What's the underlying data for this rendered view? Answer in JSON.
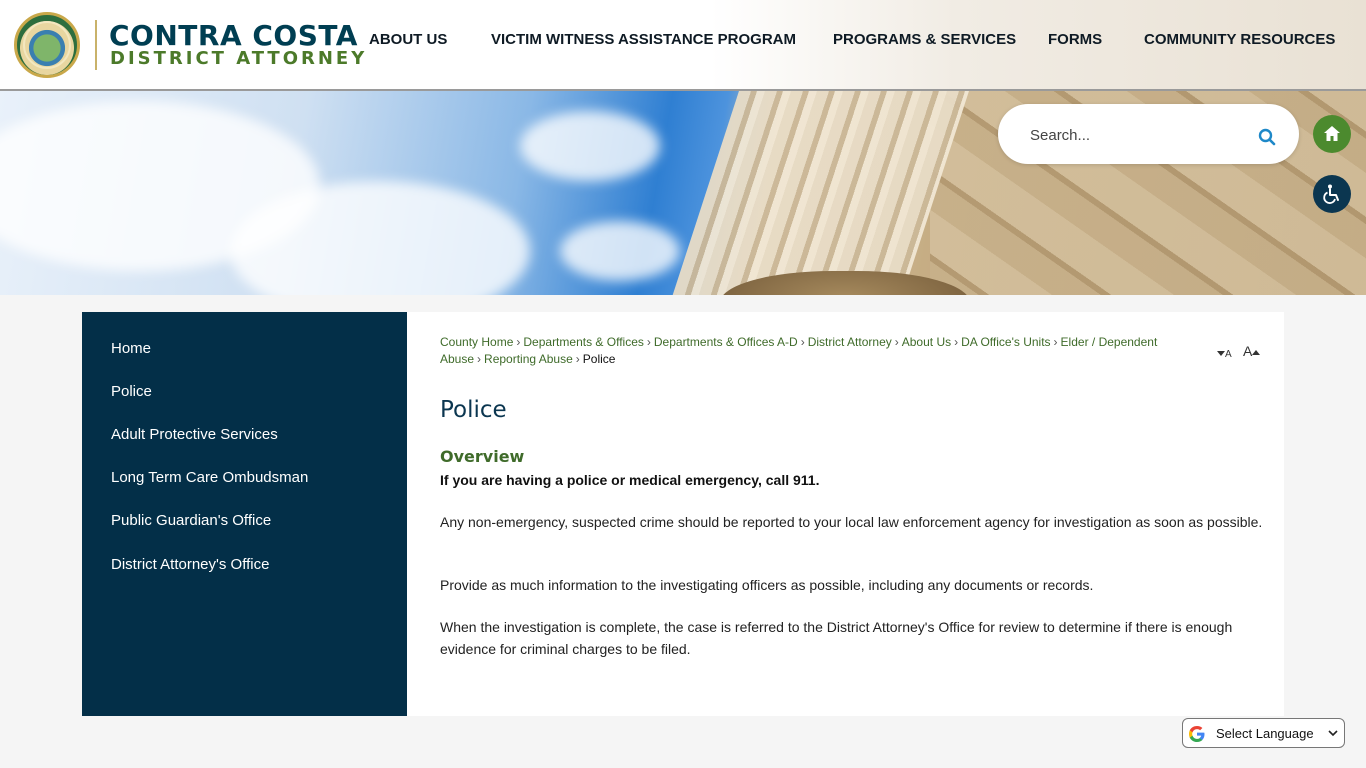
{
  "header": {
    "logo_line1": "CONTRA COSTA",
    "logo_line2": "DISTRICT ATTORNEY",
    "nav": [
      {
        "label": "ABOUT US"
      },
      {
        "label": "VICTIM WITNESS ASSISTANCE PROGRAM"
      },
      {
        "label": "PROGRAMS & SERVICES"
      },
      {
        "label": "FORMS"
      },
      {
        "label": "COMMUNITY RESOURCES"
      }
    ]
  },
  "search": {
    "placeholder": "Search...",
    "icon": "search-icon"
  },
  "buttons": {
    "home_icon": "home-icon",
    "accessibility_icon": "wheelchair-icon"
  },
  "sidebar": {
    "items": [
      {
        "label": "Home"
      },
      {
        "label": "Police"
      },
      {
        "label": "Adult Protective Services"
      },
      {
        "label": "Long Term Care Ombudsman"
      },
      {
        "label": "Public Guardian's Office"
      },
      {
        "label": "District Attorney's Office"
      }
    ]
  },
  "breadcrumb": {
    "links": [
      "County Home",
      "Departments & Offices",
      "Departments & Offices A-D",
      "District Attorney",
      "About Us",
      "DA Office's Units",
      "Elder / Dependent Abuse",
      "Reporting Abuse"
    ],
    "current": "Police",
    "separator": "›"
  },
  "font_controls": {
    "decrease": "A",
    "increase": "A"
  },
  "main": {
    "title": "Police",
    "overview_heading": "Overview",
    "emergency_text": "If you are having a police or medical emergency, call 911.",
    "paragraphs": [
      "Any non-emergency, suspected crime should be reported to your local law enforcement agency for investigation as soon as possible.",
      "Provide as much information to the investigating officers as possible, including any documents or records.",
      "When the investigation is complete, the case is referred to the District Attorney's Office for review to determine if there is enough evidence for criminal charges to be filed."
    ]
  },
  "language": {
    "label": "Select Language"
  },
  "colors": {
    "sidebar_bg": "#032f48",
    "accent_green": "#3f6b2a",
    "title_blue": "#0b3650",
    "home_button": "#4c8a2e",
    "accessibility_button": "#0b3650"
  }
}
